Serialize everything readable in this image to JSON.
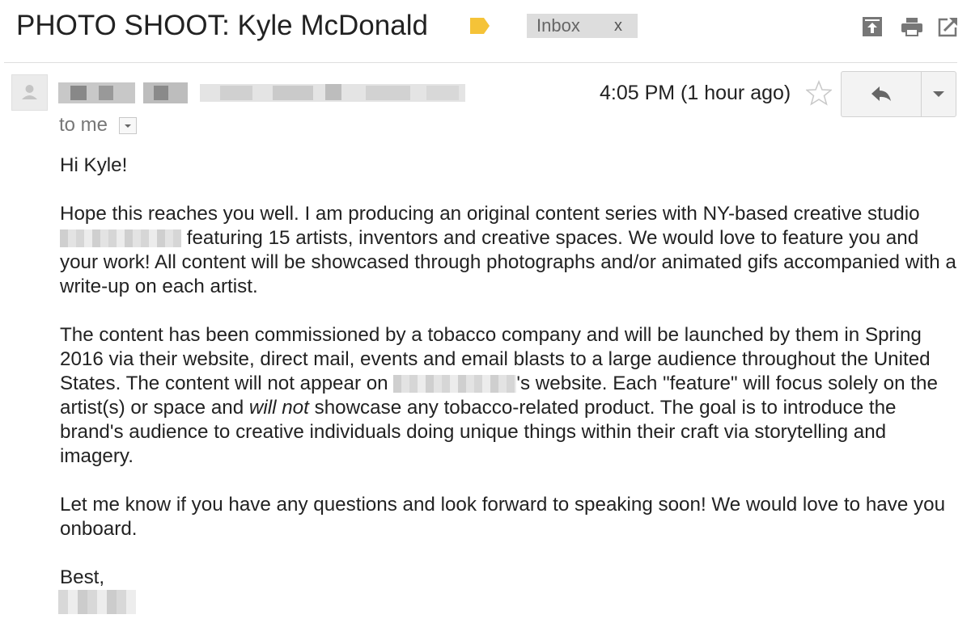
{
  "email": {
    "subject": "PHOTO SHOOT: Kyle McDonald",
    "label_color": "#f5c338",
    "inbox_label": "Inbox",
    "inbox_remove": "x",
    "toolbar_icons": [
      "archive-icon",
      "print-icon",
      "open-in-new-window-icon"
    ],
    "recipient": "to me",
    "timestamp": "4:05 PM (1 hour ago)",
    "greeting": "Hi Kyle!",
    "p1_a": "Hope this reaches you well. I am producing an original content series with NY-based creative studio",
    "p1_b": "featuring 15 artists, inventors and creative spaces. We would love to feature you and your work! All content will be showcased through photographs and/or animated gifs accompanied with a write-up on each artist.",
    "p2_a": "The content has been commissioned by a tobacco company and will be launched by them in Spring 2016 via their website, direct mail, events and email blasts to a large audience throughout the United States. The content will not appear on",
    "p2_b": "'s website. Each \"feature\" will focus solely on the artist(s) or space and",
    "p2_em": "will not",
    "p2_c": "showcase any tobacco-related product. The goal is to introduce the brand's audience to creative individuals doing unique things within their craft via storytelling and imagery.",
    "p3": "Let me know if you have any questions and look forward to speaking soon! We would love to have you onboard.",
    "closing": "Best,"
  }
}
